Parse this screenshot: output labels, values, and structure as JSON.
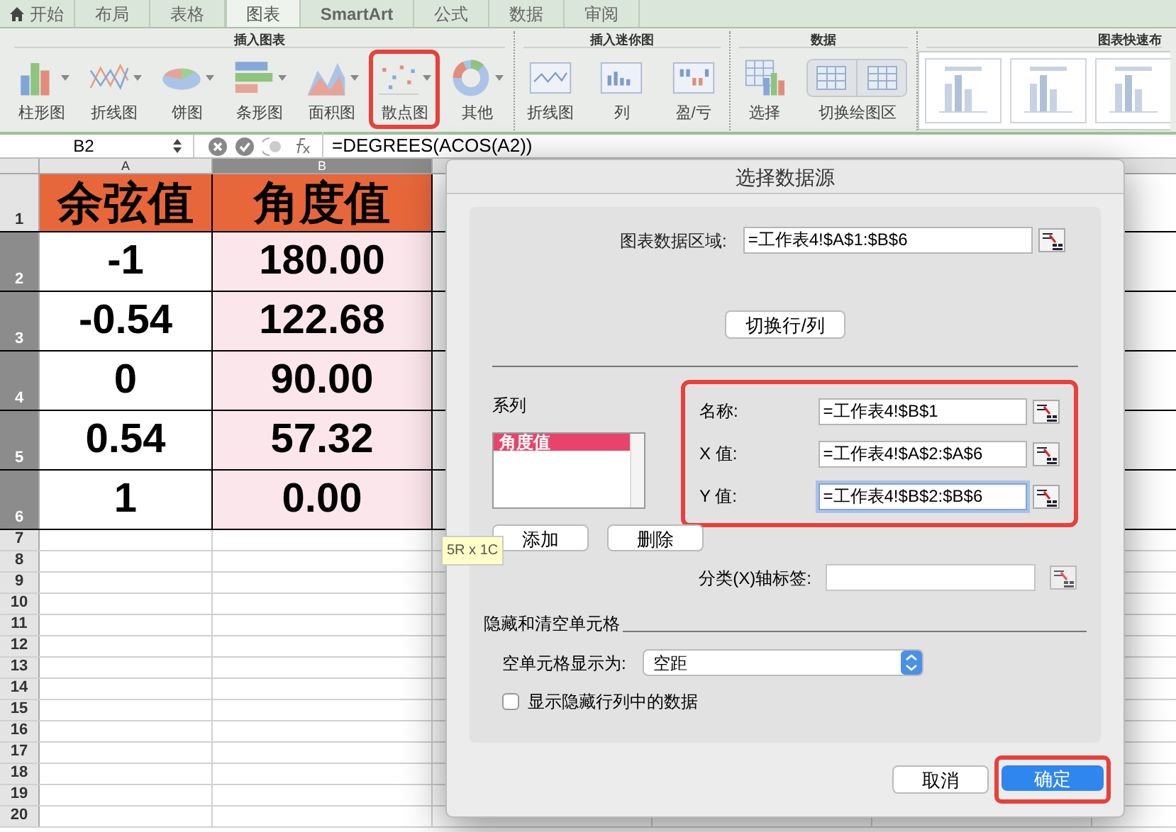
{
  "tabs": [
    {
      "label": "开始",
      "selected": false
    },
    {
      "label": "布局",
      "selected": false
    },
    {
      "label": "表格",
      "selected": false
    },
    {
      "label": "图表",
      "selected": true
    },
    {
      "label": "SmartArt",
      "selected": false
    },
    {
      "label": "公式",
      "selected": false
    },
    {
      "label": "数据",
      "selected": false
    },
    {
      "label": "审阅",
      "selected": false
    }
  ],
  "ribbon": {
    "groups": [
      {
        "title": "插入图表",
        "buttons": [
          {
            "label": "柱形图",
            "kind": "column",
            "highlighted": false
          },
          {
            "label": "折线图",
            "kind": "line",
            "highlighted": false
          },
          {
            "label": "饼图",
            "kind": "pie",
            "highlighted": false
          },
          {
            "label": "条形图",
            "kind": "bar",
            "highlighted": false
          },
          {
            "label": "面积图",
            "kind": "area",
            "highlighted": false
          },
          {
            "label": "散点图",
            "kind": "scatter",
            "highlighted": true
          },
          {
            "label": "其他",
            "kind": "donut",
            "highlighted": false
          }
        ]
      },
      {
        "title": "插入迷你图",
        "buttons": [
          {
            "label": "折线图",
            "kind": "sparkline",
            "highlighted": false
          },
          {
            "label": "列",
            "kind": "sparkcolumn",
            "highlighted": false
          },
          {
            "label": "盈/亏",
            "kind": "winloss",
            "highlighted": false
          }
        ]
      },
      {
        "title": "数据",
        "buttons": [
          {
            "label": "选择",
            "kind": "select",
            "highlighted": false
          },
          {
            "label": "切换绘图区",
            "kind": "switch",
            "highlighted": false
          }
        ]
      },
      {
        "title": "图表快速布",
        "kind": "gallery"
      }
    ]
  },
  "formula_bar": {
    "name_box": "B2",
    "formula": "=DEGREES(ACOS(A2))"
  },
  "sheet": {
    "columns": [
      {
        "label": "A",
        "selected": false
      },
      {
        "label": "B",
        "selected": true
      }
    ],
    "rows": [
      {
        "number": "1",
        "kind": "header",
        "selected": false,
        "cells": [
          {
            "text": "余弦值"
          },
          {
            "text": "角度值"
          }
        ]
      },
      {
        "number": "2",
        "kind": "data",
        "selected": true,
        "cells": [
          {
            "text": "-1",
            "selected": false
          },
          {
            "text": "180.00",
            "selected": true
          }
        ]
      },
      {
        "number": "3",
        "kind": "data",
        "selected": true,
        "cells": [
          {
            "text": "-0.54",
            "selected": false
          },
          {
            "text": "122.68",
            "selected": true
          }
        ]
      },
      {
        "number": "4",
        "kind": "data",
        "selected": true,
        "cells": [
          {
            "text": "0",
            "selected": false
          },
          {
            "text": "90.00",
            "selected": true
          }
        ]
      },
      {
        "number": "5",
        "kind": "data",
        "selected": true,
        "cells": [
          {
            "text": "0.54",
            "selected": false
          },
          {
            "text": "57.32",
            "selected": true
          }
        ]
      },
      {
        "number": "6",
        "kind": "data",
        "selected": true,
        "cells": [
          {
            "text": "1",
            "selected": false
          },
          {
            "text": "0.00",
            "selected": true
          }
        ]
      },
      {
        "number": "7",
        "kind": "empty",
        "selected": false
      },
      {
        "number": "8",
        "kind": "empty",
        "selected": false
      },
      {
        "number": "9",
        "kind": "empty",
        "selected": false
      },
      {
        "number": "10",
        "kind": "empty",
        "selected": false
      },
      {
        "number": "11",
        "kind": "empty",
        "selected": false
      },
      {
        "number": "12",
        "kind": "empty",
        "selected": false
      },
      {
        "number": "13",
        "kind": "empty",
        "selected": false
      },
      {
        "number": "14",
        "kind": "empty",
        "selected": false
      },
      {
        "number": "15",
        "kind": "empty",
        "selected": false
      },
      {
        "number": "16",
        "kind": "empty",
        "selected": false
      },
      {
        "number": "17",
        "kind": "empty",
        "selected": false
      },
      {
        "number": "18",
        "kind": "empty",
        "selected": false
      },
      {
        "number": "19",
        "kind": "empty",
        "selected": false
      },
      {
        "number": "20",
        "kind": "empty",
        "selected": false
      }
    ]
  },
  "tooltip": "5R x 1C",
  "dialog": {
    "title": "选择数据源",
    "data_range": {
      "label": "图表数据区域:",
      "value": "=工作表4!$A$1:$B$6"
    },
    "switch_button": "切换行/列",
    "series_label": "系列",
    "series": [
      {
        "label": "角度值",
        "selected": true
      }
    ],
    "add_button": "添加",
    "delete_button": "删除",
    "fields_highlighted": true,
    "fields": [
      {
        "label": "名称:",
        "value": "=工作表4!$B$1",
        "focused": false
      },
      {
        "label": "X 值:",
        "value": "=工作表4!$A$2:$A$6",
        "focused": false
      },
      {
        "label": "Y 值:",
        "value": "=工作表4!$B$2:$B$6",
        "focused": true
      }
    ],
    "category": {
      "label": "分类(X)轴标签:"
    },
    "hidden_section": "隐藏和清空单元格",
    "empty_cells": {
      "label": "空单元格显示为:",
      "value": "空距"
    },
    "show_hidden": {
      "label": "显示隐藏行列中的数据",
      "checked": false
    },
    "cancel_button": "取消",
    "ok_button": {
      "label": "确定",
      "highlighted": true
    }
  }
}
